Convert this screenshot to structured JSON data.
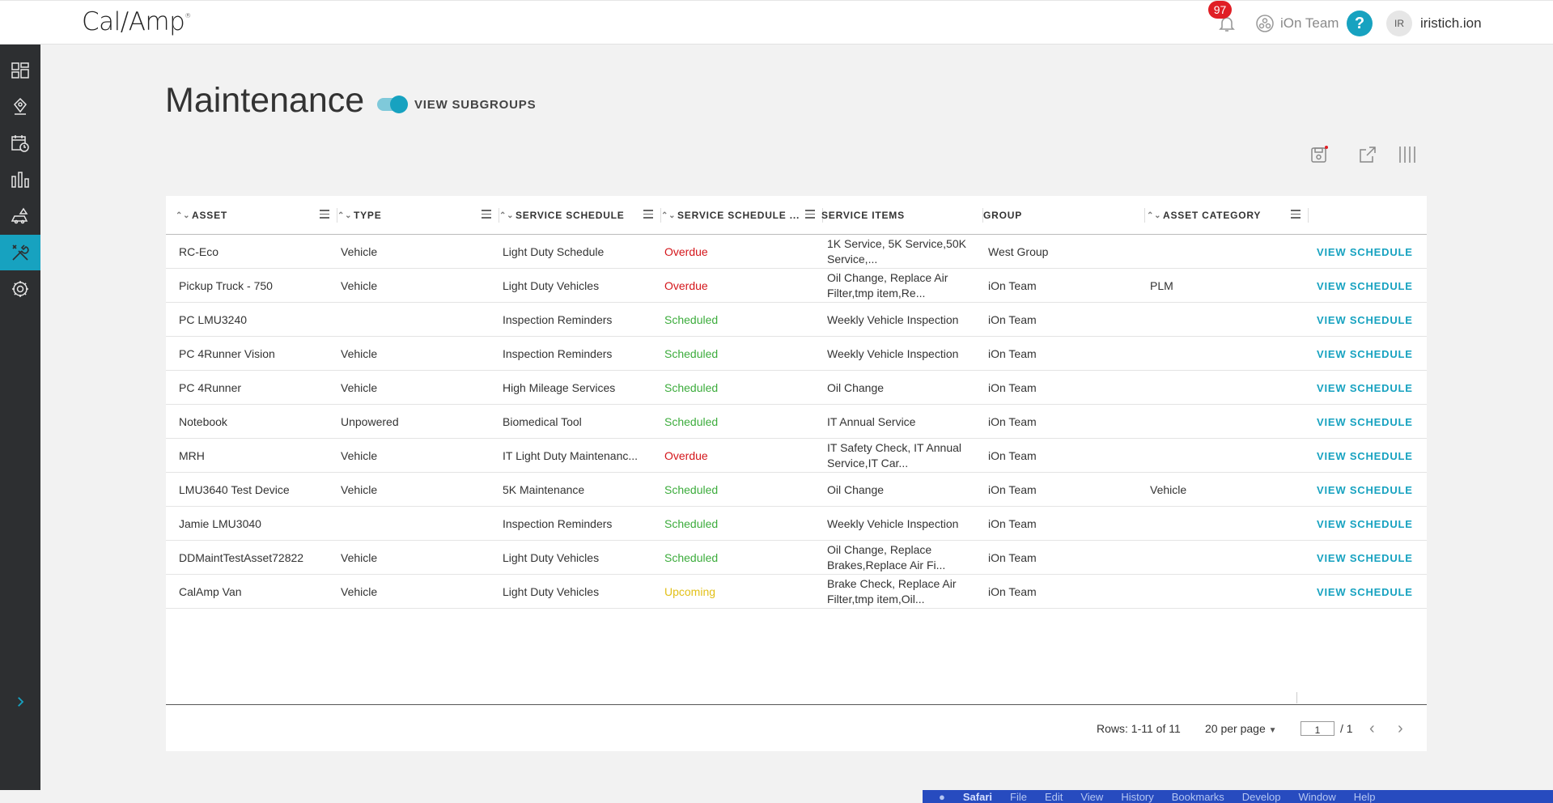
{
  "header": {
    "logo": "Cal/Amp",
    "logo_mark": "®",
    "notifications_count": "97",
    "team": "iOn Team",
    "help": "?",
    "avatar_initials": "IR",
    "username": "iristich.ion"
  },
  "sidebar": {
    "items": [
      {
        "icon": "dashboard-icon"
      },
      {
        "icon": "location-pin-icon"
      },
      {
        "icon": "calendar-clock-icon"
      },
      {
        "icon": "bar-chart-icon"
      },
      {
        "icon": "vehicle-alert-icon"
      },
      {
        "icon": "wrench-tools-icon",
        "active": true
      },
      {
        "icon": "gear-icon"
      }
    ],
    "expand_icon": "chevron-right-icon"
  },
  "page": {
    "title": "Maintenance",
    "toggle_label": "VIEW SUBGROUPS",
    "toggle_on": true
  },
  "table": {
    "columns": [
      "ASSET",
      "TYPE",
      "SERVICE SCHEDULE",
      "SERVICE SCHEDULE ...",
      "SERVICE ITEMS",
      "GROUP",
      "ASSET CATEGORY"
    ],
    "action_label": "VIEW SCHEDULE",
    "rows": [
      {
        "asset": "RC-Eco",
        "type": "Vehicle",
        "schedule": "Light Duty Schedule",
        "status": "Overdue",
        "items": "1K Service, 5K Service,50K Service,...",
        "group": "West Group",
        "category": ""
      },
      {
        "asset": "Pickup Truck - 750",
        "type": "Vehicle",
        "schedule": "Light Duty Vehicles",
        "status": "Overdue",
        "items": "Oil Change, Replace Air Filter,tmp item,Re...",
        "group": "iOn Team",
        "category": "PLM"
      },
      {
        "asset": "PC LMU3240",
        "type": "",
        "schedule": "Inspection Reminders",
        "status": "Scheduled",
        "items": "Weekly Vehicle Inspection",
        "group": "iOn Team",
        "category": ""
      },
      {
        "asset": "PC 4Runner Vision",
        "type": "Vehicle",
        "schedule": "Inspection Reminders",
        "status": "Scheduled",
        "items": "Weekly Vehicle Inspection",
        "group": "iOn Team",
        "category": ""
      },
      {
        "asset": "PC 4Runner",
        "type": "Vehicle",
        "schedule": "High Mileage Services",
        "status": "Scheduled",
        "items": "Oil Change",
        "group": "iOn Team",
        "category": ""
      },
      {
        "asset": "Notebook",
        "type": "Unpowered",
        "schedule": "Biomedical Tool",
        "status": "Scheduled",
        "items": "IT Annual Service",
        "group": "iOn Team",
        "category": ""
      },
      {
        "asset": "MRH",
        "type": "Vehicle",
        "schedule": "IT Light Duty Maintenanc...",
        "status": "Overdue",
        "items": "IT Safety Check, IT Annual Service,IT Car...",
        "group": "iOn Team",
        "category": ""
      },
      {
        "asset": "LMU3640 Test Device",
        "type": "Vehicle",
        "schedule": "5K Maintenance",
        "status": "Scheduled",
        "items": "Oil Change",
        "group": "iOn Team",
        "category": "Vehicle"
      },
      {
        "asset": "Jamie LMU3040",
        "type": "",
        "schedule": "Inspection Reminders",
        "status": "Scheduled",
        "items": "Weekly Vehicle Inspection",
        "group": "iOn Team",
        "category": ""
      },
      {
        "asset": "DDMaintTestAsset72822",
        "type": "Vehicle",
        "schedule": "Light Duty Vehicles",
        "status": "Scheduled",
        "items": "Oil Change, Replace Brakes,Replace Air Fi...",
        "group": "iOn Team",
        "category": ""
      },
      {
        "asset": "CalAmp Van",
        "type": "Vehicle",
        "schedule": "Light Duty Vehicles",
        "status": "Upcoming",
        "items": "Brake Check, Replace Air Filter,tmp item,Oil...",
        "group": "iOn Team",
        "category": ""
      }
    ]
  },
  "footer": {
    "rows_label": "Rows: 1-11 of 11",
    "per_page": "20 per page",
    "page": "1",
    "total_pages": "/ 1",
    "prev": "‹",
    "next": "›"
  },
  "status_colors": {
    "Overdue": "#d4161b",
    "Scheduled": "#3cac3c",
    "Upcoming": "#e2c018"
  },
  "accent": "#17a2c0",
  "os_menu": [
    "",
    "Safari",
    "File",
    "Edit",
    "View",
    "History",
    "Bookmarks",
    "Develop",
    "Window",
    "Help"
  ]
}
